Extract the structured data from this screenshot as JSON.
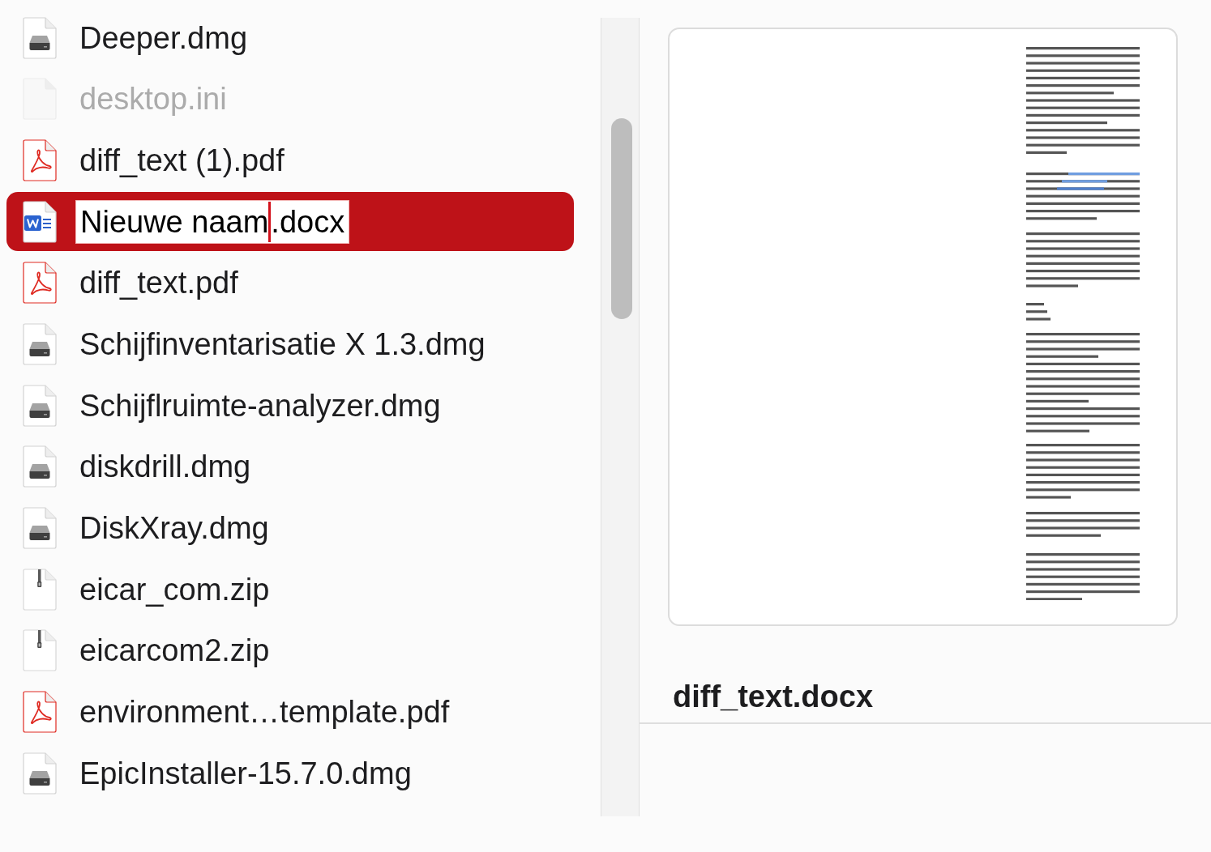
{
  "files": [
    {
      "name": "Deeper.dmg",
      "kind": "disk",
      "selected": false,
      "dimmed": false,
      "renaming": false
    },
    {
      "name": "desktop.ini",
      "kind": "blank",
      "selected": false,
      "dimmed": true,
      "renaming": false
    },
    {
      "name": "diff_text (1).pdf",
      "kind": "pdf",
      "selected": false,
      "dimmed": false,
      "renaming": false
    },
    {
      "name": "Nieuwe naam.docx",
      "kind": "word",
      "selected": true,
      "dimmed": false,
      "renaming": true
    },
    {
      "name": "diff_text.pdf",
      "kind": "pdf",
      "selected": false,
      "dimmed": false,
      "renaming": false
    },
    {
      "name": "Schijfinventarisatie X 1.3.dmg",
      "kind": "disk",
      "selected": false,
      "dimmed": false,
      "renaming": false
    },
    {
      "name": "Schijflruimte-analyzer.dmg",
      "kind": "disk",
      "selected": false,
      "dimmed": false,
      "renaming": false
    },
    {
      "name": "diskdrill.dmg",
      "kind": "disk",
      "selected": false,
      "dimmed": false,
      "renaming": false
    },
    {
      "name": "DiskXray.dmg",
      "kind": "disk",
      "selected": false,
      "dimmed": false,
      "renaming": false
    },
    {
      "name": "eicar_com.zip",
      "kind": "zip",
      "selected": false,
      "dimmed": false,
      "renaming": false
    },
    {
      "name": "eicarcom2.zip",
      "kind": "zip",
      "selected": false,
      "dimmed": false,
      "renaming": false
    },
    {
      "name": "environment…template.pdf",
      "kind": "pdf",
      "selected": false,
      "dimmed": false,
      "renaming": false
    },
    {
      "name": "EpicInstaller-15.7.0.dmg",
      "kind": "disk",
      "selected": false,
      "dimmed": false,
      "renaming": false
    }
  ],
  "preview": {
    "title": "diff_text.docx"
  }
}
